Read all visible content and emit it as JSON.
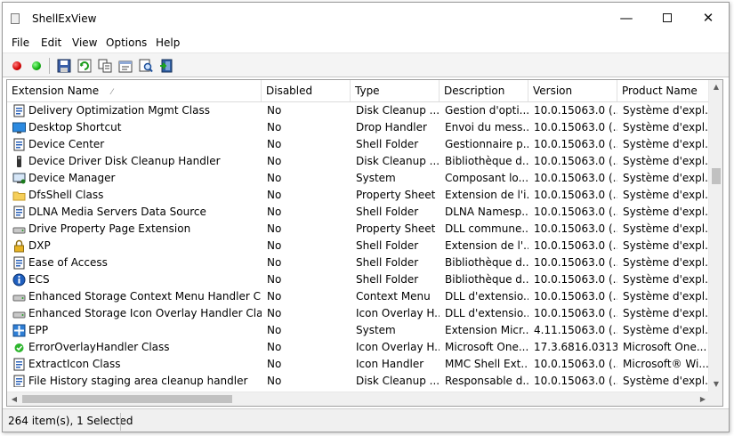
{
  "window": {
    "title": "ShellExView"
  },
  "menu": [
    "File",
    "Edit",
    "View",
    "Options",
    "Help"
  ],
  "columns": [
    "Extension Name",
    "Disabled",
    "Type",
    "Description",
    "Version",
    "Product Name"
  ],
  "rows": [
    {
      "icon": "document-icon",
      "name": "Delivery Optimization Mgmt Class",
      "disabled": "No",
      "type": "Disk Cleanup ...",
      "description": "Gestion d'opti...",
      "version": "10.0.15063.0 (...",
      "product": "Système d'expl..."
    },
    {
      "icon": "desktop-icon",
      "name": "Desktop Shortcut",
      "disabled": "No",
      "type": "Drop Handler",
      "description": "Envoi du mess...",
      "version": "10.0.15063.0 (...",
      "product": "Système d'expl..."
    },
    {
      "icon": "document-icon",
      "name": "Device Center",
      "disabled": "No",
      "type": "Shell Folder",
      "description": "Gestionnaire p...",
      "version": "10.0.15063.0 (...",
      "product": "Système d'expl..."
    },
    {
      "icon": "usb-icon",
      "name": "Device Driver Disk Cleanup Handler",
      "disabled": "No",
      "type": "Disk Cleanup ...",
      "description": "Bibliothèque d...",
      "version": "10.0.15063.0 (...",
      "product": "Système d'expl..."
    },
    {
      "icon": "device-manager-icon",
      "name": "Device Manager",
      "disabled": "No",
      "type": "System",
      "description": "Composant lo...",
      "version": "10.0.15063.0 (...",
      "product": "Système d'expl..."
    },
    {
      "icon": "folder-icon",
      "name": "DfsShell Class",
      "disabled": "No",
      "type": "Property Sheet",
      "description": "Extension de l'i...",
      "version": "10.0.15063.0 (...",
      "product": "Système d'expl..."
    },
    {
      "icon": "document-icon",
      "name": "DLNA Media Servers Data Source",
      "disabled": "No",
      "type": "Shell Folder",
      "description": "DLNA Namesp...",
      "version": "10.0.15063.0 (...",
      "product": "Système d'expl..."
    },
    {
      "icon": "drive-icon",
      "name": "Drive Property Page Extension",
      "disabled": "No",
      "type": "Property Sheet",
      "description": "DLL commune...",
      "version": "10.0.15063.0 (...",
      "product": "Système d'expl..."
    },
    {
      "icon": "lock-icon",
      "name": "DXP",
      "disabled": "No",
      "type": "Shell Folder",
      "description": "Extension de l'...",
      "version": "10.0.15063.0 (...",
      "product": "Système d'expl..."
    },
    {
      "icon": "document-icon",
      "name": "Ease of Access",
      "disabled": "No",
      "type": "Shell Folder",
      "description": "Bibliothèque d...",
      "version": "10.0.15063.0 (...",
      "product": "Système d'expl..."
    },
    {
      "icon": "info-icon",
      "name": "ECS",
      "disabled": "No",
      "type": "Shell Folder",
      "description": "Bibliothèque d...",
      "version": "10.0.15063.0 (...",
      "product": "Système d'expl..."
    },
    {
      "icon": "drive-icon",
      "name": "Enhanced Storage Context Menu Handler Class",
      "disabled": "No",
      "type": "Context Menu",
      "description": "DLL d'extensio...",
      "version": "10.0.15063.0 (...",
      "product": "Système d'expl..."
    },
    {
      "icon": "drive-icon",
      "name": "Enhanced Storage Icon Overlay Handler Class",
      "disabled": "No",
      "type": "Icon Overlay H...",
      "description": "DLL d'extensio...",
      "version": "10.0.15063.0 (...",
      "product": "Système d'expl..."
    },
    {
      "icon": "epp-icon",
      "name": "EPP",
      "disabled": "No",
      "type": "System",
      "description": "Extension Micr...",
      "version": "4.11.15063.0 (...",
      "product": "Système d'expl..."
    },
    {
      "icon": "check-icon",
      "name": "ErrorOverlayHandler Class",
      "disabled": "No",
      "type": "Icon Overlay H...",
      "description": "Microsoft One...",
      "version": "17.3.6816.0313",
      "product": "Microsoft One..."
    },
    {
      "icon": "document-icon",
      "name": "ExtractIcon Class",
      "disabled": "No",
      "type": "Icon Handler",
      "description": "MMC Shell Ext...",
      "version": "10.0.15063.0 (...",
      "product": "Microsoft® Wi..."
    },
    {
      "icon": "document-icon",
      "name": "File History staging area cleanup handler",
      "disabled": "No",
      "type": "Disk Cleanup ...",
      "description": "Responsable d...",
      "version": "10.0.15063.0 (...",
      "product": "Système d'expl..."
    }
  ],
  "status": {
    "text": "264 item(s), 1 Selected"
  }
}
